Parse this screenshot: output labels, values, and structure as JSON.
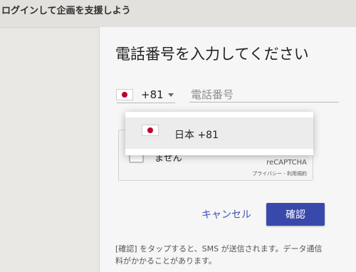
{
  "header": {
    "title": "ログインして企画を支援しよう"
  },
  "dialog": {
    "title": "電話番号を入力してください",
    "country": {
      "flag_icon": "japan-flag-icon",
      "dial_code": "+81",
      "expand_icon": "caret-down-icon"
    },
    "phone_input": {
      "placeholder": "電話番号",
      "value": ""
    },
    "recaptcha": {
      "label": "ません",
      "brand": "reCAPTCHA",
      "links": "プライバシー - 利用規約"
    },
    "cancel_label": "キャンセル",
    "confirm_label": "確認",
    "notice": "[確認] をタップすると、SMS が送信されます。データ通信料がかかることがあります。"
  },
  "country_dropdown": {
    "options": [
      {
        "flag_icon": "japan-flag-icon",
        "label": "日本 +81"
      }
    ]
  },
  "colors": {
    "accent": "#3949ab",
    "link": "#3f51b5",
    "flag_red": "#bc002d"
  }
}
